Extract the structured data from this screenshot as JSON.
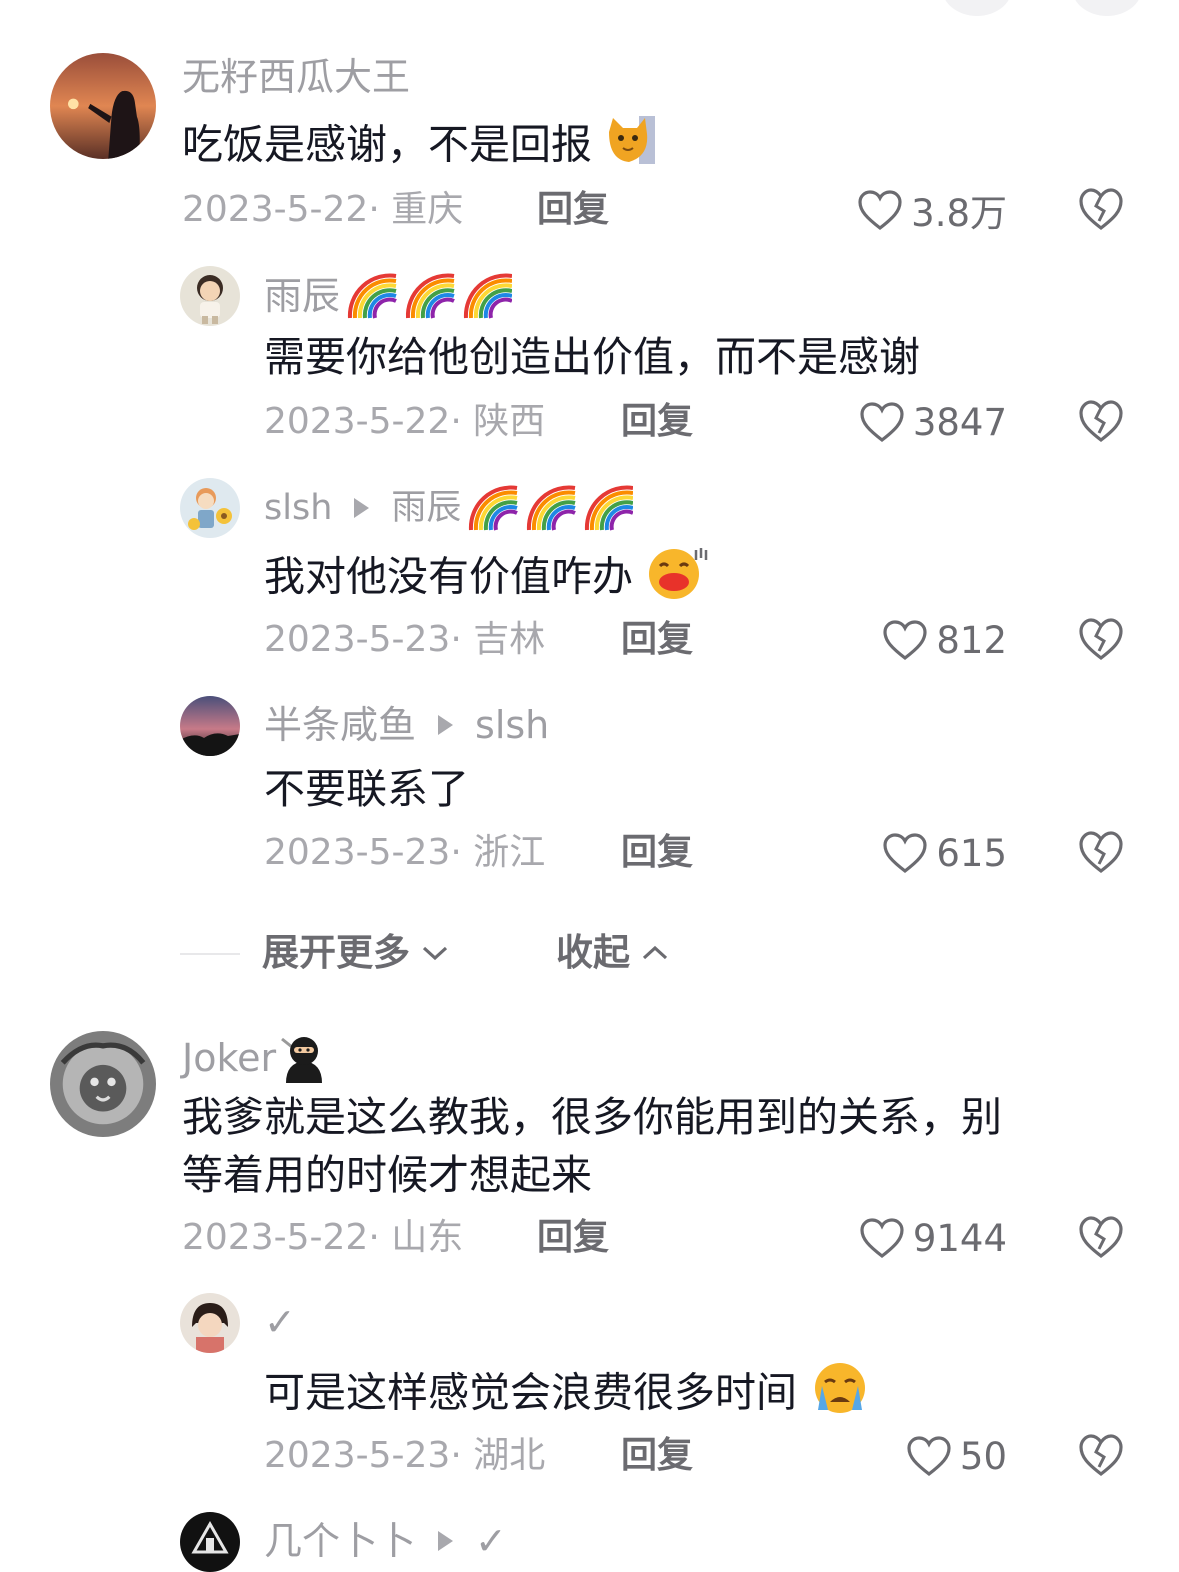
{
  "comments": [
    {
      "username": "无籽西瓜大王",
      "text": "吃饭是感谢，不是回报",
      "date": "2023-5-22",
      "location": "· 重庆",
      "reply_label": "回复",
      "likes": "3.8万",
      "avatar_icon": "sunset-silhouette-avatar",
      "text_emoji": "cat-emoji",
      "replies": [
        {
          "username": "雨辰",
          "name_emoji": "rainbow-emoji",
          "text": "需要你给他创造出价值，而不是感谢",
          "date": "2023-5-22",
          "location": "· 陕西",
          "reply_label": "回复",
          "likes": "3847"
        },
        {
          "username": "slsh",
          "reply_to": "雨辰",
          "text": "我对他没有价值咋办",
          "date": "2023-5-23",
          "location": "· 吉林",
          "reply_label": "回复",
          "likes": "812"
        },
        {
          "username": "半条咸鱼",
          "reply_to": "slsh",
          "text": "不要联系了",
          "date": "2023-5-23",
          "location": "· 浙江",
          "reply_label": "回复",
          "likes": "615"
        }
      ]
    },
    {
      "username": "Joker",
      "text_line1": "我爹就是这么教我，很多你能用到的关系，别",
      "text_line2": "等着用的时候才想起来",
      "date": "2023-5-22",
      "location": "· 山东",
      "reply_label": "回复",
      "likes": "9144",
      "avatar_icon": "lion-sketch-avatar",
      "name_emoji": "ninja-emoji",
      "replies": [
        {
          "username": "✓",
          "text": "可是这样感觉会浪费很多时间",
          "date": "2023-5-23",
          "location": "· 湖北",
          "reply_label": "回复",
          "likes": "50",
          "text_emoji": "crying-face-emoji"
        },
        {
          "username": "几个卜卜",
          "reply_to": "✓"
        }
      ]
    }
  ],
  "thread_controls": {
    "expand_label": "展开更多",
    "collapse_label": "收起"
  },
  "colors": {
    "text": "#161823",
    "muted": "#a8a8ad",
    "action": "#6b6b70"
  }
}
